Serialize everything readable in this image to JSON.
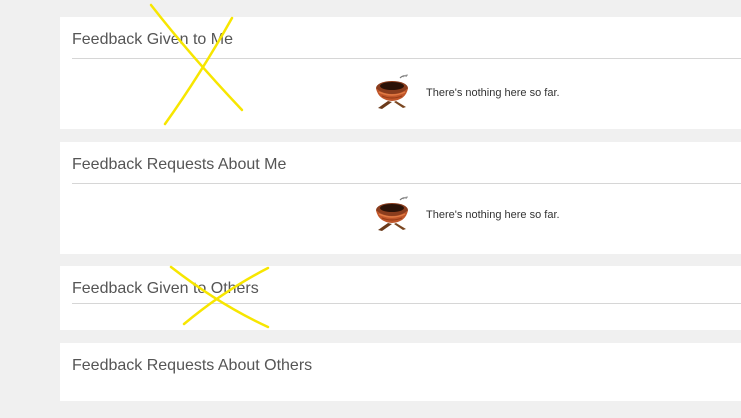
{
  "sections": [
    {
      "title": "Feedback Given to Me",
      "empty_message": "There's nothing here so far."
    },
    {
      "title": "Feedback Requests About Me",
      "empty_message": "There's nothing here so far."
    },
    {
      "title": "Feedback Given to Others"
    },
    {
      "title": "Feedback Requests About Others"
    }
  ],
  "colors": {
    "page_background": "#f0f0f0",
    "panel_background": "#ffffff",
    "title_text": "#555555",
    "rule": "#d6d6d6",
    "scribble_marks": "#f7e600"
  },
  "icons": {
    "empty_state": "bird-nest-icon"
  }
}
